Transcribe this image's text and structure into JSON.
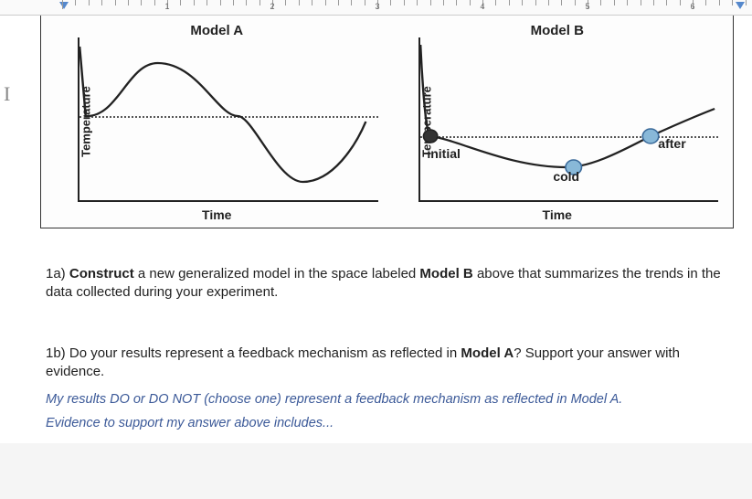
{
  "ruler": {
    "marks": [
      1,
      2,
      3,
      4,
      5,
      6
    ]
  },
  "cursor": "I",
  "chart_data": [
    {
      "type": "line",
      "title": "Model A",
      "xlabel": "Time",
      "ylabel": "Temperature",
      "baseline_y": 0.48,
      "x": [
        0.0,
        0.25,
        0.5,
        0.75,
        0.95
      ],
      "y": [
        0.48,
        0.15,
        0.48,
        0.88,
        0.5
      ],
      "description": "Damped sine-like oscillation of temperature over time, crossing a dotted baseline."
    },
    {
      "type": "line",
      "title": "Model B",
      "xlabel": "Time",
      "ylabel": "Temperature",
      "baseline_y": 0.6,
      "x": [
        0.04,
        0.5,
        0.78,
        0.98
      ],
      "y": [
        0.6,
        0.78,
        0.6,
        0.5
      ],
      "annotations": [
        {
          "label": "initial",
          "x": 0.04,
          "y": 0.6
        },
        {
          "label": "cold",
          "x": 0.5,
          "y": 0.78
        },
        {
          "label": "after",
          "x": 0.78,
          "y": 0.6
        }
      ],
      "description": "Hand-drawn curve starting at baseline (initial), dipping to a minimum (cold), rising past baseline (after) then continuing upward."
    }
  ],
  "charts": {
    "a": {
      "title": "Model A",
      "xlabel": "Time",
      "ylabel": "Temperature"
    },
    "b": {
      "title": "Model B",
      "xlabel": "Time",
      "ylabel": "Temperature",
      "ann_initial": "initial",
      "ann_cold": "cold",
      "ann_after": "after"
    }
  },
  "q1a": {
    "prefix": "1a)",
    "verb": "Construct",
    "text_mid": "a new generalized model in the space labeled",
    "model_ref": "Model B",
    "text_end": "above that summarizes the trends in the data collected during your experiment."
  },
  "q1b": {
    "prefix": "1b)",
    "text_start": "Do your results represent a feedback mechanism as reflected in",
    "model_ref": "Model A",
    "text_end": "? Support your answer with evidence."
  },
  "answer_templates": {
    "line1": "My results DO or DO NOT (choose one) represent a feedback mechanism as reflected in Model A.",
    "line2": "Evidence to support my answer above includes..."
  }
}
